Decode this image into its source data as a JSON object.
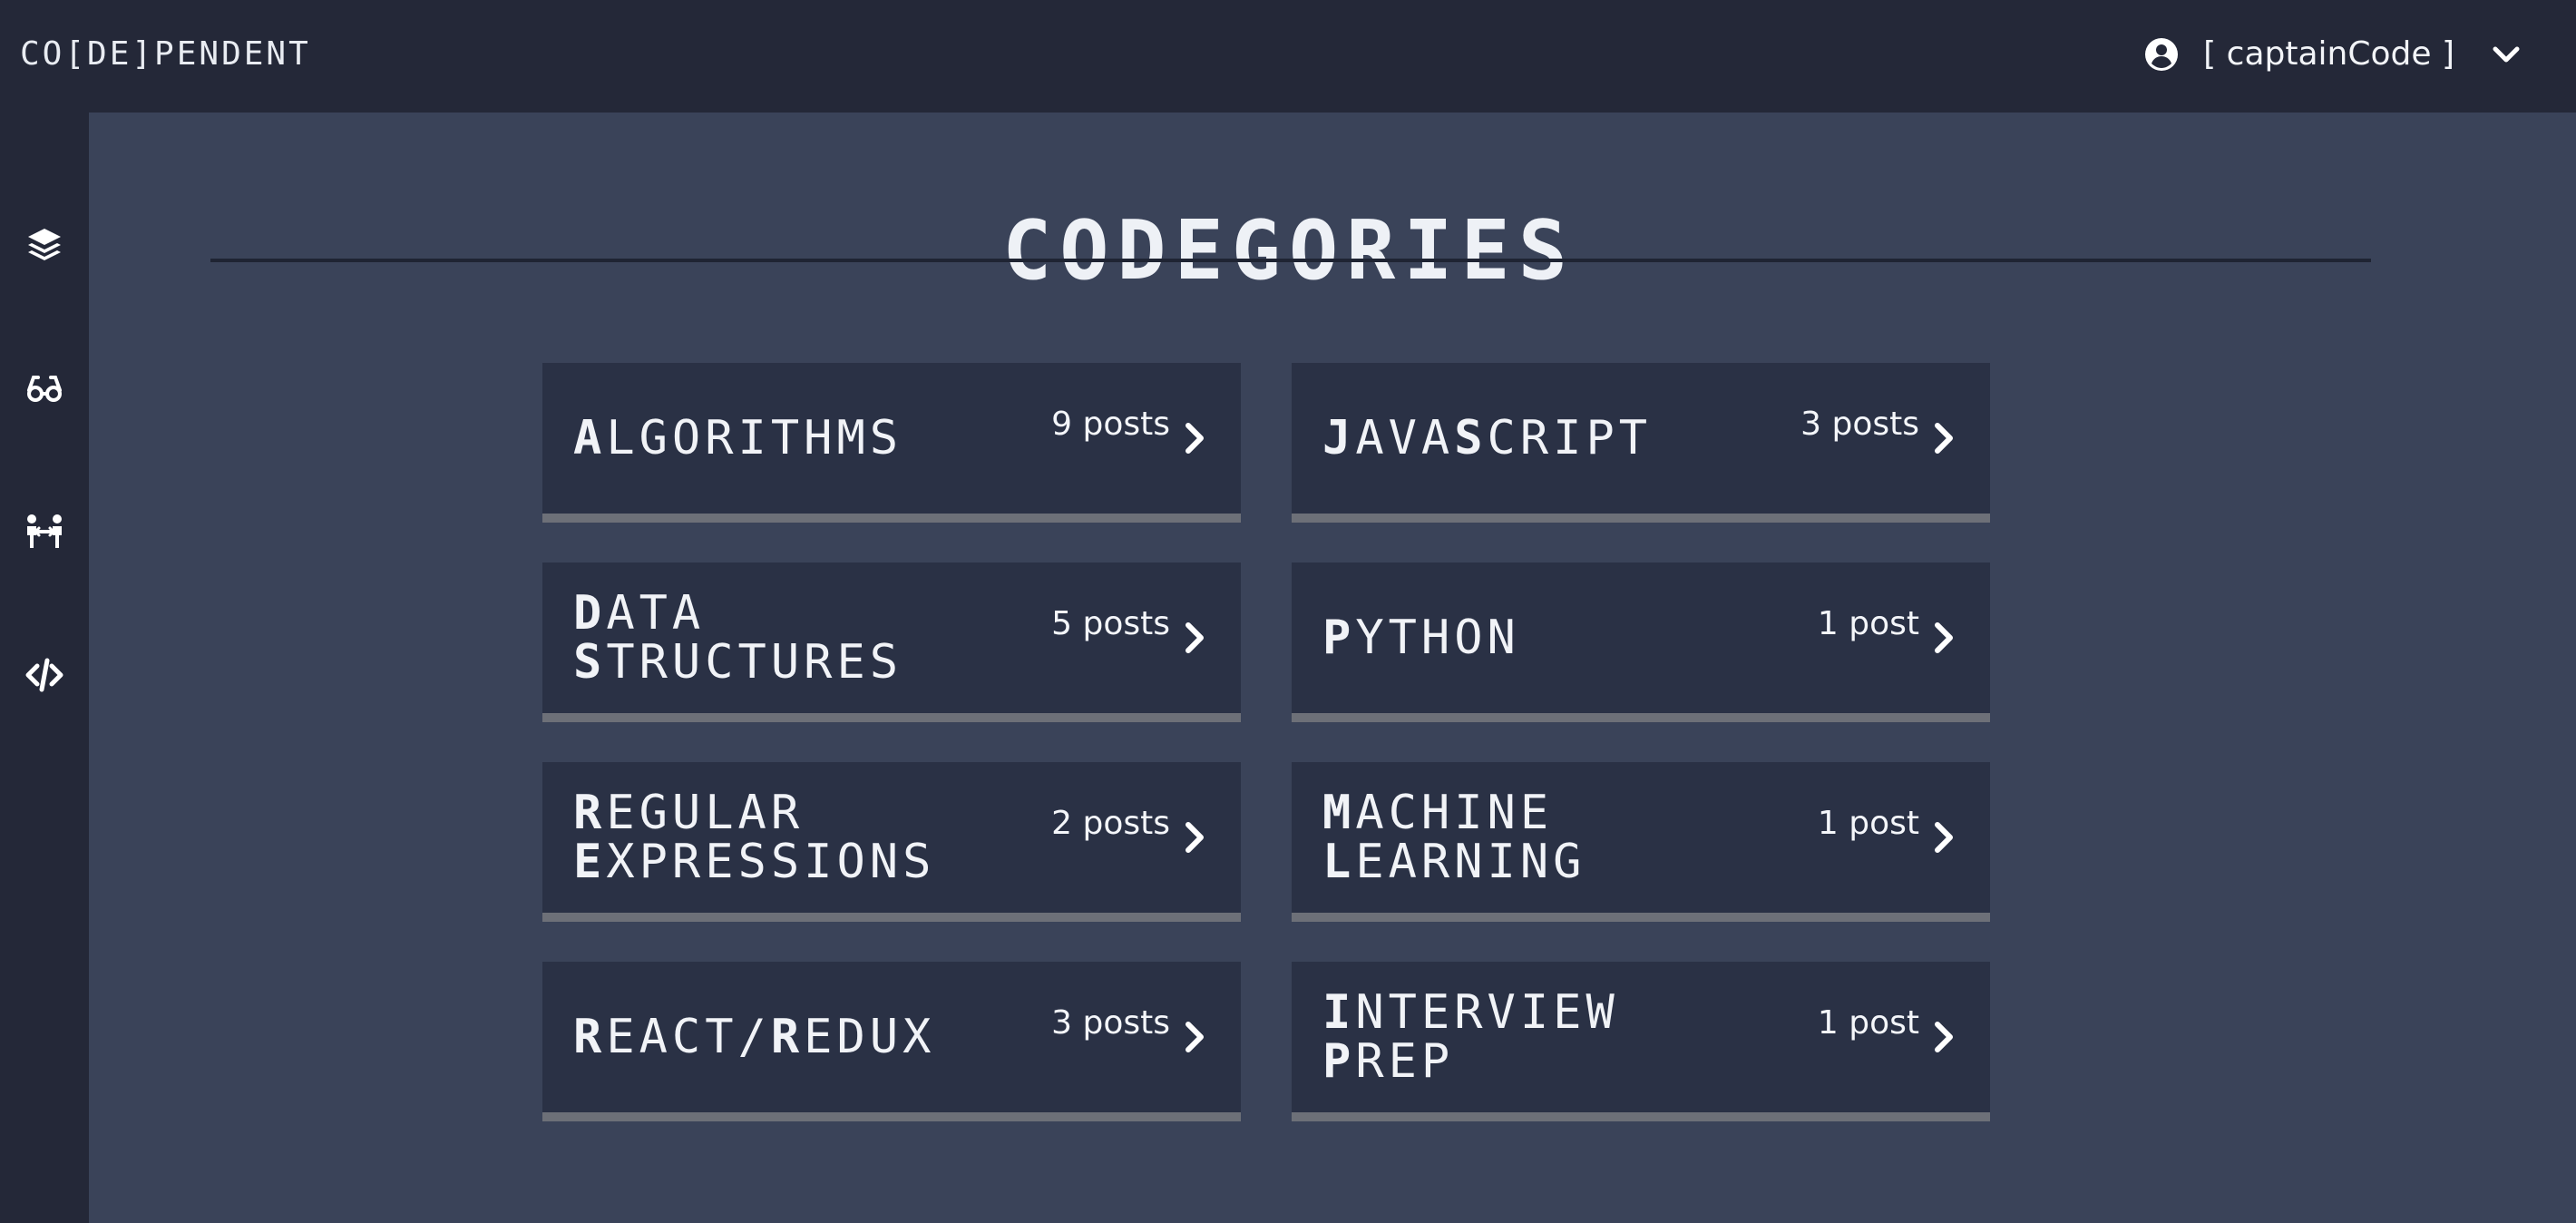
{
  "header": {
    "brand": "CO[DE]PENDENT",
    "user_name": "[ captainCode ]",
    "user_icon": "user-circle-icon",
    "menu_icon": "chevron-down-icon"
  },
  "sidebar": {
    "items": [
      {
        "icon": "layers-icon"
      },
      {
        "icon": "glasses-icon"
      },
      {
        "icon": "people-connection-icon"
      },
      {
        "icon": "code-icon"
      }
    ]
  },
  "main": {
    "title_first": "C",
    "title_rest": "ODEGORIES",
    "categories": [
      {
        "line1_first": "A",
        "line1_rest": "LGORITHMS",
        "line2_first": "",
        "line2_rest": "",
        "count": "9 posts"
      },
      {
        "line1_first": "J",
        "line1_rest": "AVA",
        "line1_mid_first": "S",
        "line1_mid_rest": "CRIPT",
        "line2_first": "",
        "line2_rest": "",
        "count": "3 posts"
      },
      {
        "line1_first": "D",
        "line1_rest": "ATA",
        "line2_first": "S",
        "line2_rest": "TRUCTURES",
        "count": "5 posts"
      },
      {
        "line1_first": "P",
        "line1_rest": "YTHON",
        "line2_first": "",
        "line2_rest": "",
        "count": "1 post"
      },
      {
        "line1_first": "R",
        "line1_rest": "EGULAR",
        "line2_first": "E",
        "line2_rest": "XPRESSIONS",
        "count": "2 posts"
      },
      {
        "line1_first": "M",
        "line1_rest": "ACHINE",
        "line2_first": "L",
        "line2_rest": "EARNING",
        "count": "1 post"
      },
      {
        "line1_first": "R",
        "line1_rest": "EACT/",
        "line1_mid_first": "R",
        "line1_mid_rest": "EDUX",
        "line2_first": "",
        "line2_rest": "",
        "count": "3 posts"
      },
      {
        "line1_first": "I",
        "line1_rest": "NTERVIEW",
        "line2_first": "P",
        "line2_rest": "REP",
        "count": "1 post"
      }
    ]
  },
  "colors": {
    "background": "#3a4359",
    "header": "#242838",
    "card": "#2a3145",
    "card_border": "#6d7078",
    "text": "#ffffff"
  }
}
